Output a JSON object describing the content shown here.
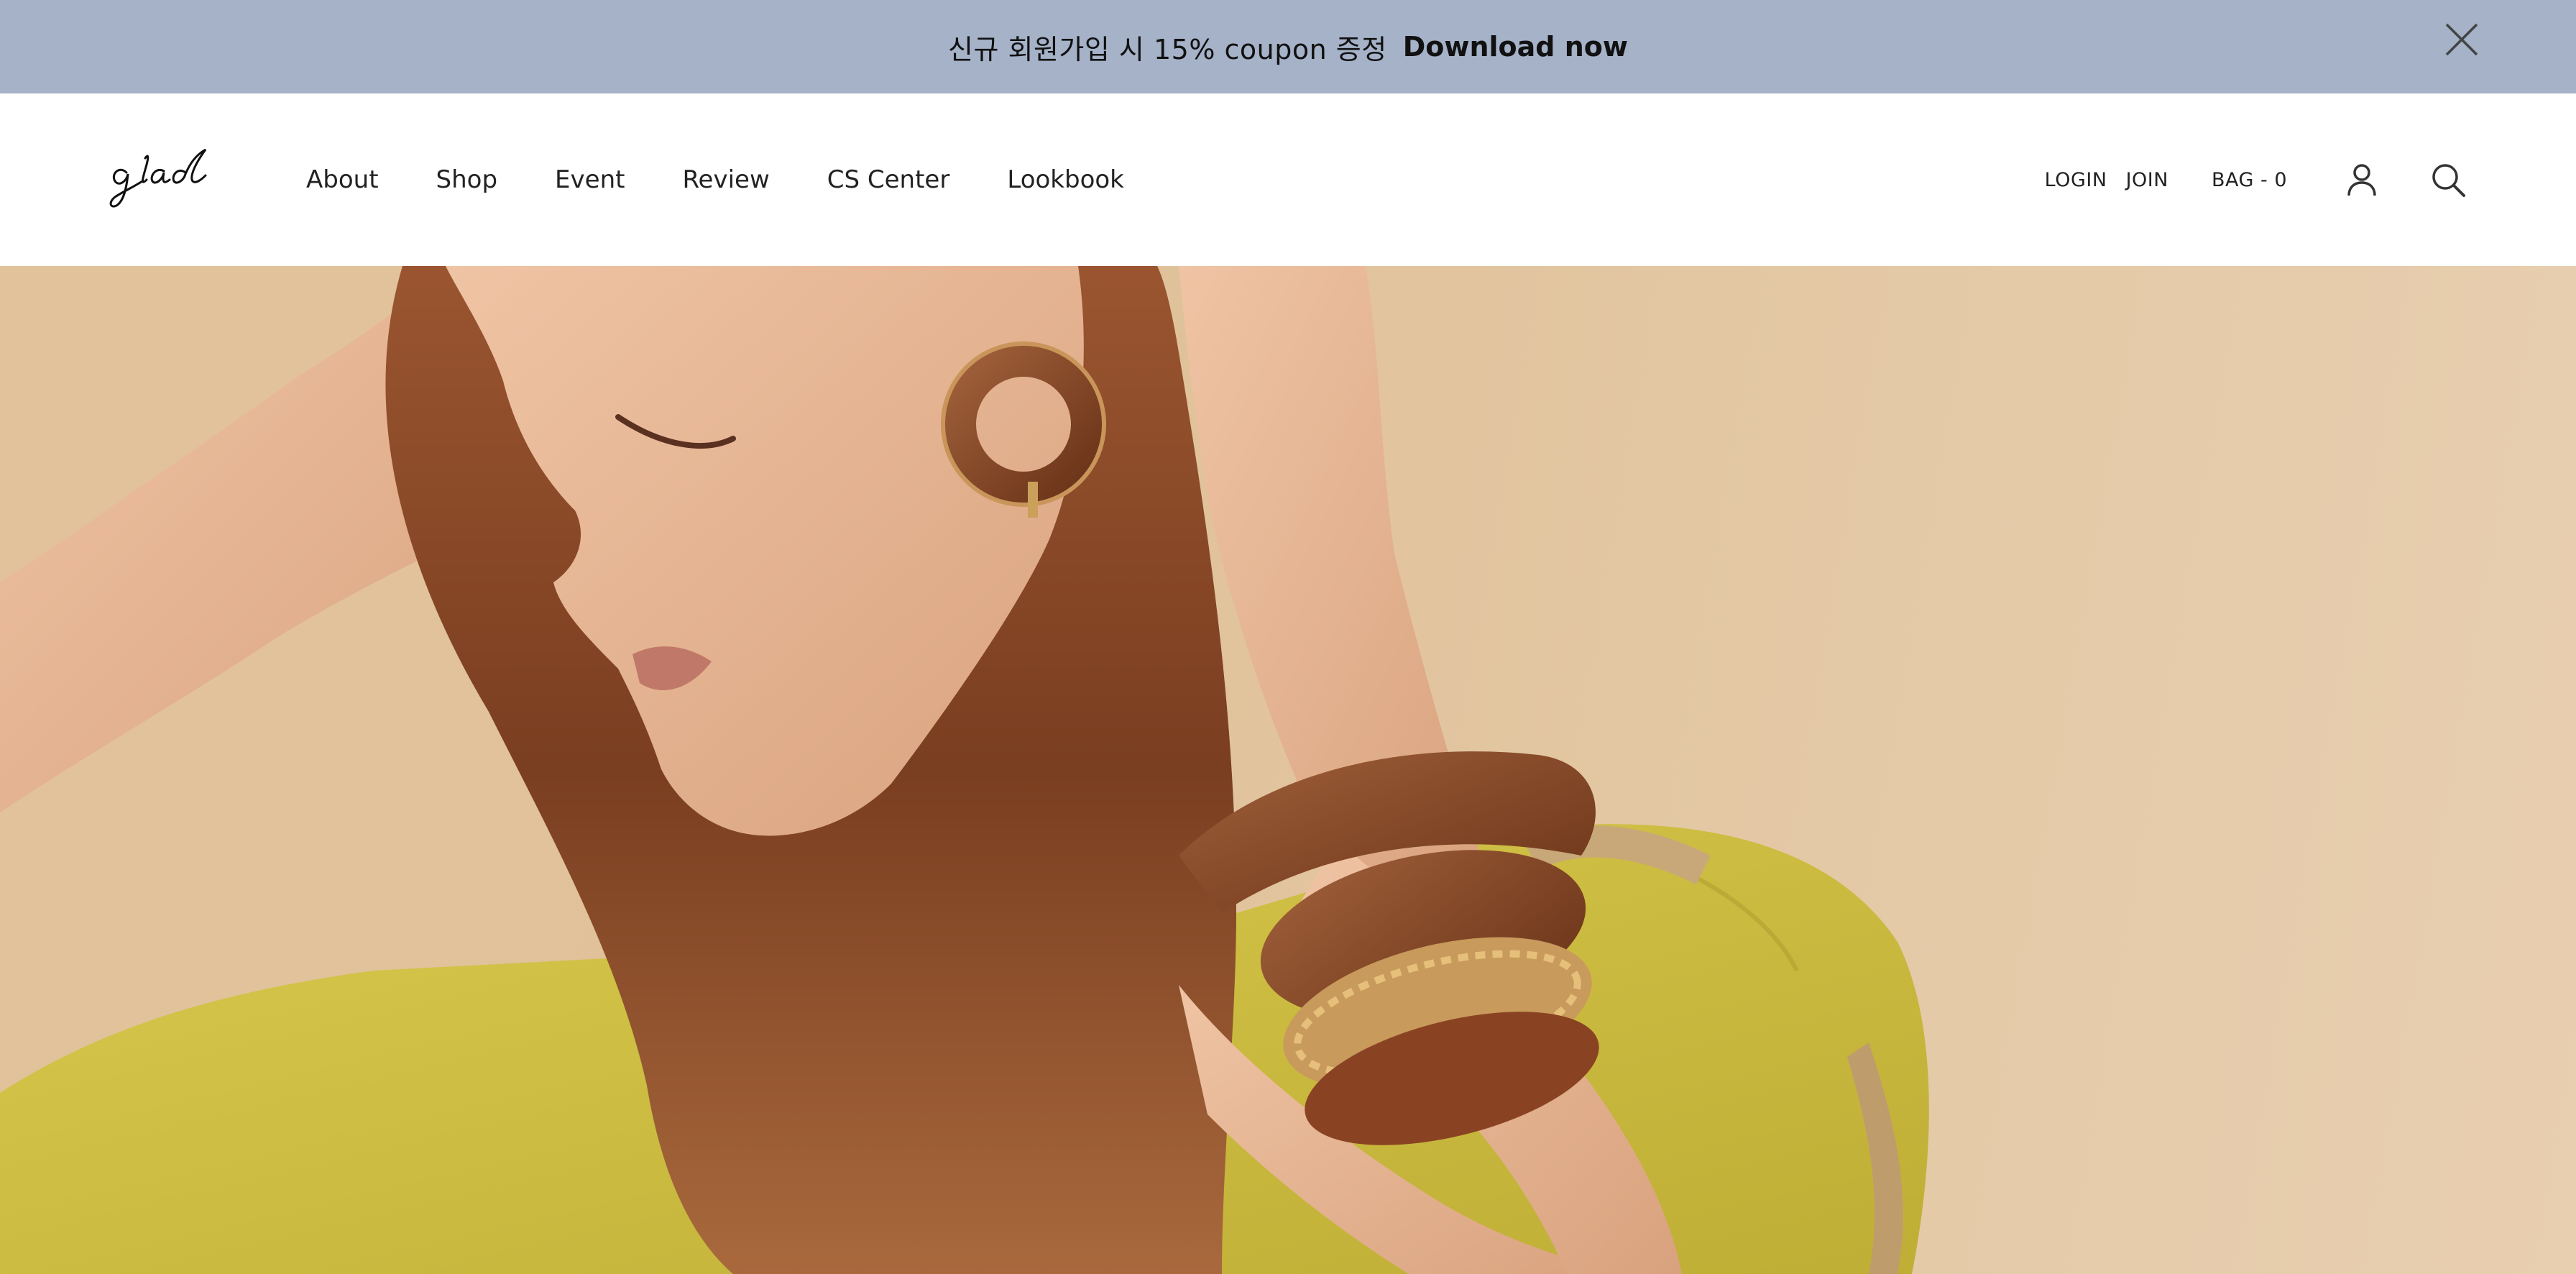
{
  "promo": {
    "text": "신규 회원가입 시 15% coupon 증정",
    "cta": "Download now"
  },
  "header": {
    "logo_text": "glad",
    "nav": [
      {
        "label": "About"
      },
      {
        "label": "Shop"
      },
      {
        "label": "Event"
      },
      {
        "label": "Review"
      },
      {
        "label": "CS Center"
      },
      {
        "label": "Lookbook"
      }
    ],
    "util": {
      "login": "LOGIN",
      "join": "JOIN",
      "bag": "BAG - 0"
    }
  },
  "hero": {
    "image": "model-yellow-dress-wooden-jewelry",
    "colors": {
      "background": "#e0c199",
      "dress": "#cfc043",
      "hair": "#8a4a28",
      "skin": "#e6b696",
      "wood": "#7a3b1e"
    }
  },
  "colors": {
    "banner": "#a5b2c8",
    "text": "#111111"
  }
}
